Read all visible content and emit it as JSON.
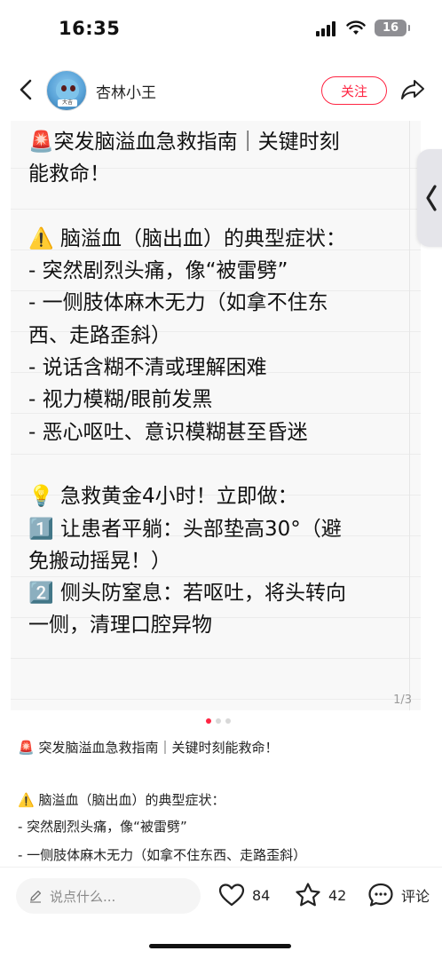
{
  "status_bar": {
    "time": "16:35",
    "battery": "16"
  },
  "header": {
    "username": "杏林小王",
    "follow_label": "关注",
    "avatar_tag": "大吉"
  },
  "note_image": {
    "lines": [
      "🚨突发脑溢血急救指南｜关键时刻",
      "能救命！",
      "",
      "⚠️ 脑溢血（脑出血）的典型症状：",
      "- 突然剧烈头痛，像“被雷劈”",
      "- 一侧肢体麻木无力（如拿不住东",
      "西、走路歪斜）",
      "- 说话含糊不清或理解困难",
      "- 视力模糊/眼前发黑",
      "- 恶心呕吐、意识模糊甚至昏迷",
      "",
      "💡 急救黄金4小时！立即做：",
      "1️⃣ 让患者平躺：头部垫高30°（避",
      "免搬动摇晃！）",
      "2️⃣ 侧头防窒息：若呕吐，将头转向",
      "一侧，清理口腔异物"
    ],
    "page_counter": "1/3"
  },
  "carousel": {
    "total": 3,
    "active": 0
  },
  "description": {
    "lines": [
      "🚨 突发脑溢血急救指南｜关键时刻能救命！",
      "",
      "⚠️ 脑溢血（脑出血）的典型症状：",
      "- 突然剧烈头痛，像“被雷劈”",
      "- 一侧肢体麻木无力（如拿不住东西、走路歪斜）"
    ]
  },
  "bottom_bar": {
    "comment_placeholder": "说点什么...",
    "likes": "84",
    "collects": "42",
    "comment_label": "评论"
  },
  "colors": {
    "accent": "#ff2442",
    "note_bg": "#f8f8f8"
  }
}
